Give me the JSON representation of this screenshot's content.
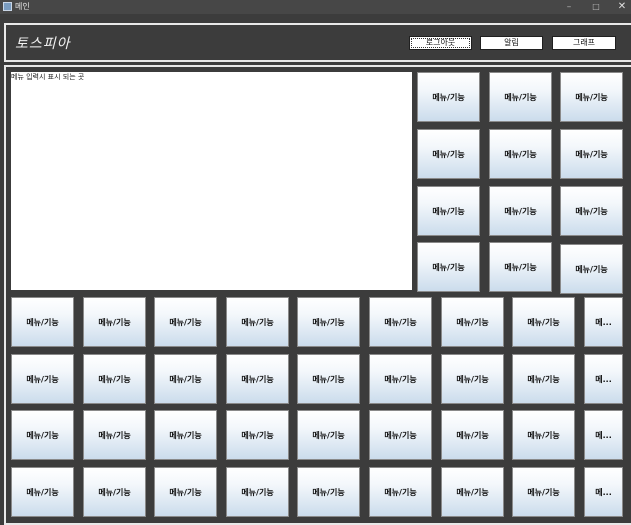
{
  "window": {
    "title": "메인",
    "minimize": "–",
    "maximize": "□",
    "close": "✕"
  },
  "header": {
    "brand": "토스피아",
    "buttons": [
      "로그아웃",
      "알림",
      "그래프"
    ]
  },
  "display": {
    "text": "메뉴 입력시 표시 되는 곳"
  },
  "side_tiles": [
    "메뉴/기능",
    "메뉴/기능",
    "메뉴/기능",
    "메뉴/기능",
    "메뉴/기능",
    "메뉴/기능",
    "메뉴/기능",
    "메뉴/기능",
    "메뉴/기능",
    "메뉴/기능",
    "메뉴/기능",
    "메뉴/기능"
  ],
  "grid_rows": [
    [
      "메뉴/기능",
      "메뉴/기능",
      "메뉴/기능",
      "메뉴/기능",
      "메뉴/기능",
      "메뉴/기능",
      "메뉴/기능",
      "메뉴/기능",
      "메..."
    ],
    [
      "메뉴/기능",
      "메뉴/기능",
      "메뉴/기능",
      "메뉴/기능",
      "메뉴/기능",
      "메뉴/기능",
      "메뉴/기능",
      "메뉴/기능",
      "메..."
    ],
    [
      "메뉴/기능",
      "메뉴/기능",
      "메뉴/기능",
      "메뉴/기능",
      "메뉴/기능",
      "메뉴/기능",
      "메뉴/기능",
      "메뉴/기능",
      "메..."
    ],
    [
      "메뉴/기능",
      "메뉴/기능",
      "메뉴/기능",
      "메뉴/기능",
      "메뉴/기능",
      "메뉴/기능",
      "메뉴/기능",
      "메뉴/기능",
      "메..."
    ]
  ]
}
